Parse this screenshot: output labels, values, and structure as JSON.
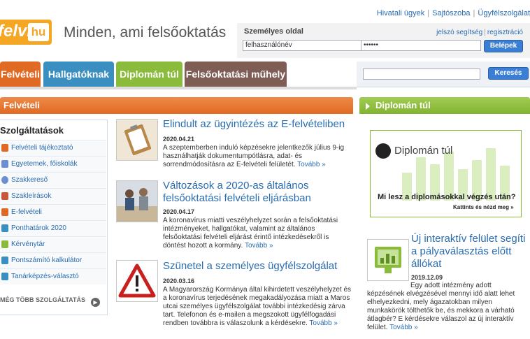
{
  "top_links": [
    "Hivatali ügyek",
    "Sajtószoba",
    "Ügyfélszolgálat"
  ],
  "logo": {
    "text": "felvi",
    "suffix": "hu"
  },
  "tagline": "Minden, ami felsőoktatás",
  "login": {
    "title": "Személyes oldal",
    "link_password_help": "jelszó segítség",
    "link_register": "regisztráció",
    "username_value": "felhasználónév",
    "password_value": "••••••",
    "button": "Belépek"
  },
  "nav_tabs": [
    "Felvételi",
    "Hallgatóknak",
    "Diplomán túl",
    "Felsőoktatási műhely"
  ],
  "search": {
    "value": "",
    "button": "Keresés"
  },
  "left_section_title": "Felvételi",
  "right_section_title": "Diplomán túl",
  "sidebar": {
    "title": "Szolgáltatások",
    "items": [
      {
        "label": "Felvételi tájékoztató",
        "color": "#e06a23"
      },
      {
        "label": "Egyetemek, főiskolák",
        "color": "#6b8fd0"
      },
      {
        "label": "Szakkereső",
        "color": "#6b8fd0"
      },
      {
        "label": "Szakleírások",
        "color": "#c8563a"
      },
      {
        "label": "E-felvételi",
        "color": "#e06a23"
      },
      {
        "label": "Ponthatárok 2020",
        "color": "#3a8fc0"
      },
      {
        "label": "Kérvénytár",
        "color": "#8abb3a"
      },
      {
        "label": "Pontszámító kalkulátor",
        "color": "#3a8fc0"
      },
      {
        "label": "Tanárképzés-választó",
        "color": "#3a8fc0"
      }
    ],
    "more": "MÉG TÖBB SZOLGÁLTATÁS"
  },
  "articles": [
    {
      "title": "Elindult az ügyintézés az E-felvételiben",
      "date": "2020.04.21",
      "text": "A szeptemberben induló képzésekre jelentkezők július 9-ig használhatják dokumentumpótlásra, adat- és sorrendmódosításra az E-felvételi felületét.",
      "more": "Tovább »"
    },
    {
      "title": "Változások a 2020-as általános felsőoktatási felvételi eljárásban",
      "date": "2020.04.17",
      "text": "A koronavírus miatti veszélyhelyzet során a felsőoktatási intézményeket, hallgatókat, valamint az általános felsőoktatási felvételi eljárást érintő intézkedésekről is döntést hozott a kormány.",
      "more": "Tovább »"
    },
    {
      "title": "Szünetel a személyes ügyfélszolgálat",
      "date": "2020.03.16",
      "text": "A Magyarország Kormánya által kihirdetett veszélyhelyzet és a koronavírus terjedésének megakadályozása miatt a Maros utcai személyes ügyfélszolgálat további intézkedésig zárva tart. Telefonon és e-mailen a megszokott ügyfélfogadási rendben továbbra is válaszolunk a kérdésekre.",
      "more": "Tovább »"
    }
  ],
  "banner": {
    "name": "Diplomán túl",
    "question": "Mi lesz a diplomásokkal végzés után?",
    "cta": "Kattints és nézd meg »",
    "accent": "#8abb3a"
  },
  "right_article": {
    "title": "Új interaktív felület segíti a pályaválasztás előtt állókat",
    "date": "2019.12.09",
    "text": "Egy adott intézmény adott képzésének elvégzésével mennyi idő alatt lehet elhelyezkedni, mely ágazatokban milyen munkakörök tölthetők be, és mekkora a várható átlagbér? E kérdésekre válaszol az új interaktív felület.",
    "more": "Tovább »"
  }
}
